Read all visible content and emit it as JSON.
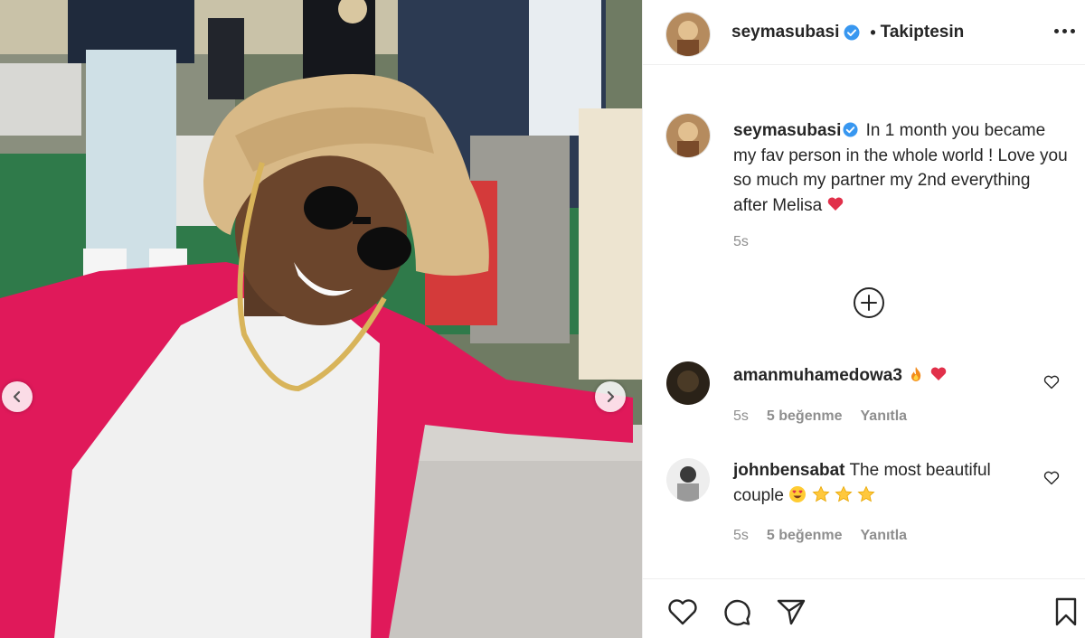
{
  "post": {
    "author": "seymasubasi",
    "follow_status": "Takiptesin",
    "caption": "In 1 month you became my fav person in the whole world ! Love you so much my partner my 2nd everything after Melisa",
    "caption_time": "5s"
  },
  "comments": [
    {
      "username": "amanmuhamedowa3",
      "text": "",
      "emojis": [
        "fire",
        "heart"
      ],
      "time": "5s",
      "likes": "5 beğenme",
      "reply": "Yanıtla"
    },
    {
      "username": "johnbensabat",
      "text": "The most beautiful couple",
      "emojis": [
        "heart-eyes",
        "star",
        "star",
        "star"
      ],
      "time": "5s",
      "likes": "5 beğenme",
      "reply": "Yanıtla"
    }
  ],
  "colors": {
    "verified": "#3897f0",
    "heart": "#ed4956",
    "text_primary": "#262626",
    "text_secondary": "#8e8e8e",
    "jacket": "#e0195a"
  },
  "icons": [
    "verified-badge-icon",
    "more-options-icon",
    "load-more-comments-icon",
    "like-icon",
    "comment-icon",
    "share-icon",
    "save-icon",
    "chevron-left-icon",
    "chevron-right-icon"
  ]
}
